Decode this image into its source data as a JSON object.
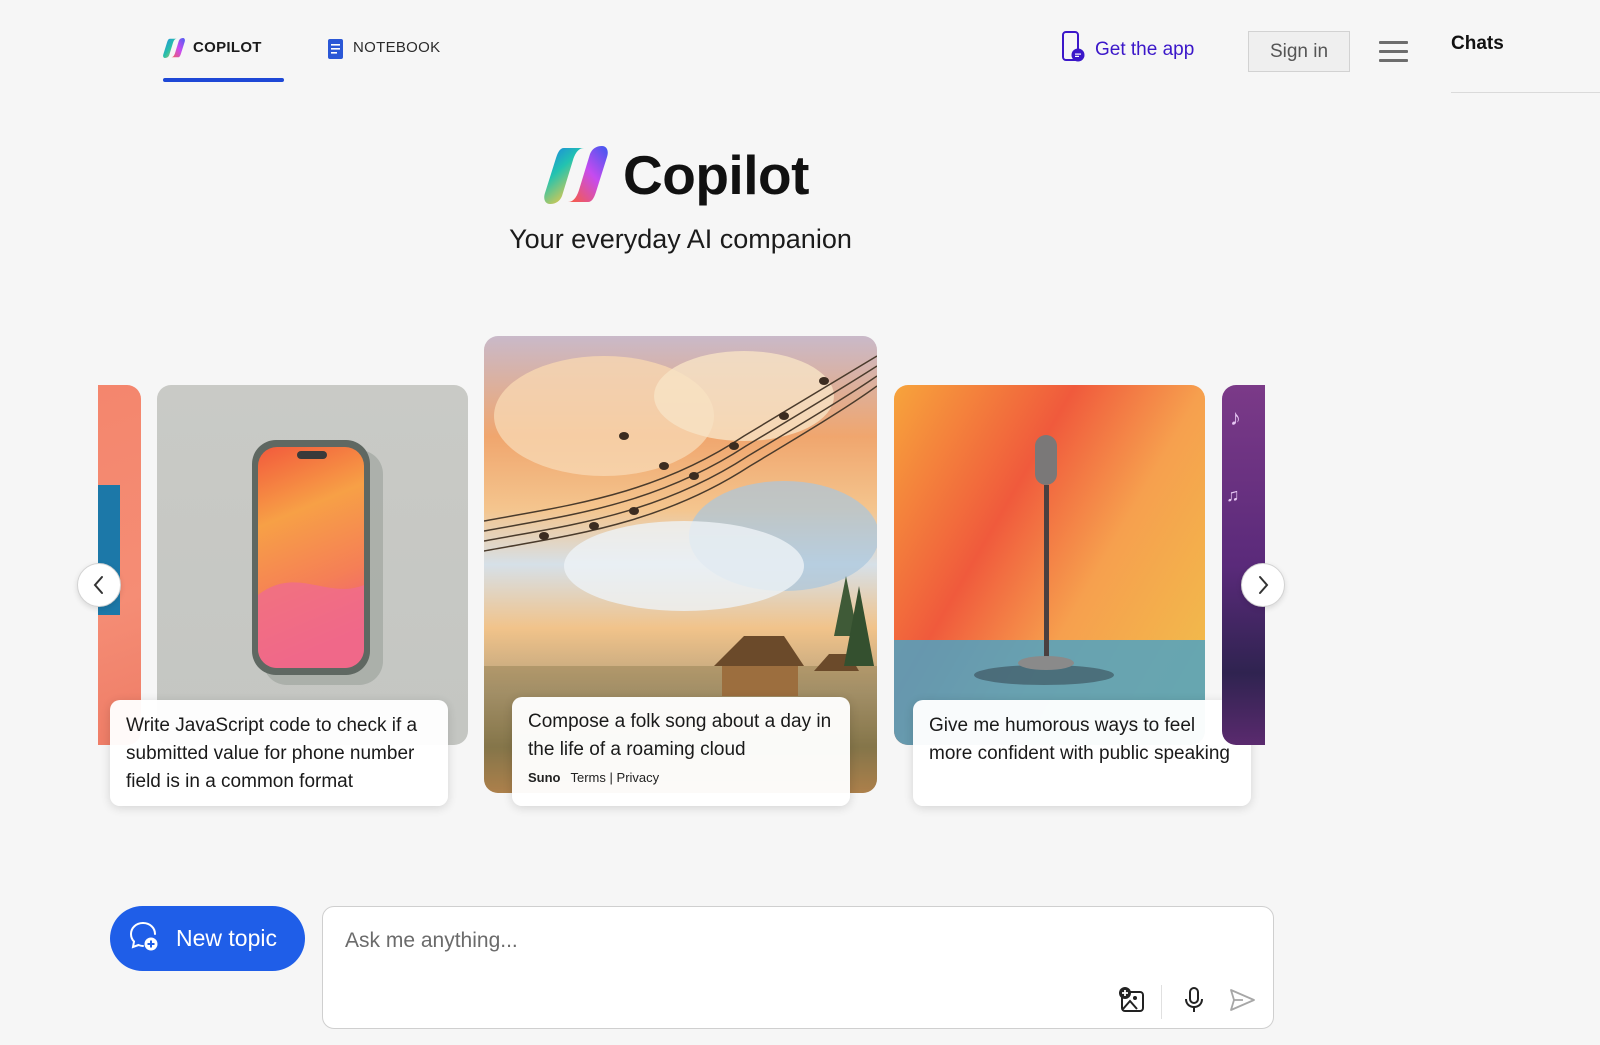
{
  "nav": {
    "tabs": [
      {
        "label": "COPILOT",
        "active": true
      },
      {
        "label": "NOTEBOOK",
        "active": false
      }
    ],
    "get_app": "Get the app",
    "sign_in": "Sign in",
    "chats": "Chats"
  },
  "hero": {
    "title": "Copilot",
    "subtitle": "Your everyday AI companion"
  },
  "carousel": {
    "cards": [
      {
        "prompt": "Write JavaScript code to check if a submitted value for phone number field is in a common format",
        "icon": "phone-illustration"
      },
      {
        "prompt": "Compose a folk song about a day in the life of a roaming cloud",
        "brand": "Suno",
        "terms": "Terms",
        "separator": "|",
        "privacy": "Privacy",
        "icon": "music-clouds-illustration"
      },
      {
        "prompt": "Give me humorous ways to feel more confident with public speaking",
        "icon": "microphone-illustration"
      }
    ]
  },
  "composer": {
    "new_topic": "New topic",
    "placeholder": "Ask me anything..."
  },
  "colors": {
    "accent": "#1e48d6",
    "new_topic_bg": "#1f5ee8",
    "get_app_text": "#3b17c9"
  }
}
